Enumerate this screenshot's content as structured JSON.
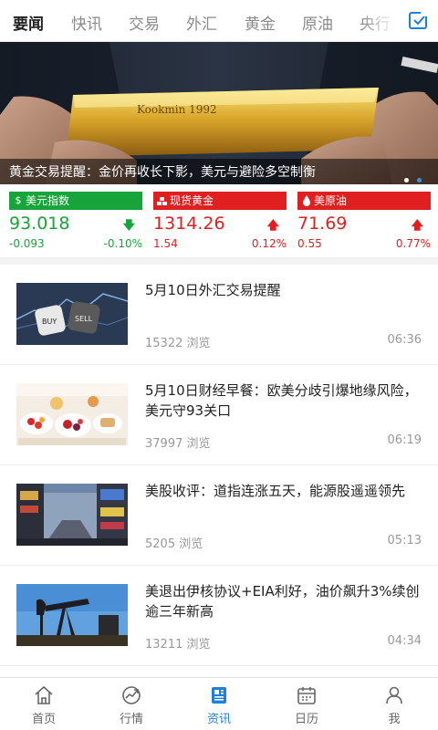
{
  "tabs": [
    "要闻",
    "快讯",
    "交易",
    "外汇",
    "黄金",
    "原油",
    "央行"
  ],
  "active_tab": 0,
  "banner": {
    "title": "黄金交易提醒：金价再收长下影，美元与避险多空制衡",
    "bar_text": "Kookmin 1992",
    "dots_total": 2,
    "dots_active": 1
  },
  "quotes": [
    {
      "name": "美元指数",
      "icon": "dollar-icon",
      "price": "93.018",
      "change": "-0.093",
      "percent": "-0.10%",
      "direction": "down",
      "header_color": "#17a43a",
      "value_color": "#17a43a"
    },
    {
      "name": "现货黄金",
      "icon": "gold-bars-icon",
      "price": "1314.26",
      "change": "1.54",
      "percent": "0.12%",
      "direction": "up",
      "header_color": "#e02020",
      "value_color": "#e02020"
    },
    {
      "name": "美原油",
      "icon": "oil-drop-icon",
      "price": "71.69",
      "change": "0.55",
      "percent": "0.77%",
      "direction": "up",
      "header_color": "#e02020",
      "value_color": "#e02020"
    }
  ],
  "news": [
    {
      "title": "5月10日外汇交易提醒",
      "views": "15322 浏览",
      "time": "06:36",
      "thumb": "buy-sell-dice"
    },
    {
      "title": "5月10日财经早餐：欧美分歧引爆地缘风险，美元守93关口",
      "views": "37997 浏览",
      "time": "06:19",
      "thumb": "breakfast-table"
    },
    {
      "title": "美股收评：道指连涨五天，能源股遥遥领先",
      "views": "5205 浏览",
      "time": "05:13",
      "thumb": "city-street"
    },
    {
      "title": "美退出伊核协议+EIA利好，油价飙升3%续创逾三年新高",
      "views": "13211 浏览",
      "time": "04:34",
      "thumb": "oil-pump"
    }
  ],
  "bottom_nav": [
    {
      "label": "首页",
      "icon": "home-icon"
    },
    {
      "label": "行情",
      "icon": "market-chart-icon"
    },
    {
      "label": "资讯",
      "icon": "news-icon"
    },
    {
      "label": "日历",
      "icon": "calendar-icon"
    },
    {
      "label": "我",
      "icon": "profile-icon"
    }
  ],
  "active_nav": 2,
  "colors": {
    "accent": "#1f7fd8",
    "up": "#e02020",
    "down": "#17a43a"
  }
}
